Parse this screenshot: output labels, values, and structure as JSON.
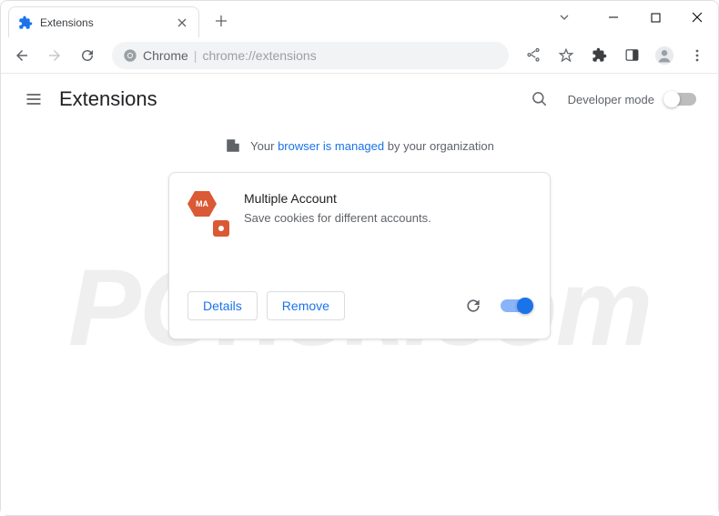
{
  "tab": {
    "title": "Extensions"
  },
  "addressbar": {
    "label": "Chrome",
    "url": "chrome://extensions"
  },
  "header": {
    "title": "Extensions",
    "devmode_label": "Developer mode"
  },
  "notice": {
    "prefix": "Your ",
    "link": "browser is managed",
    "suffix": " by your organization"
  },
  "extension": {
    "name": "Multiple Account",
    "description": "Save cookies for different accounts.",
    "icon_text": "MA",
    "details_label": "Details",
    "remove_label": "Remove"
  },
  "watermark": "PCrisk.com"
}
